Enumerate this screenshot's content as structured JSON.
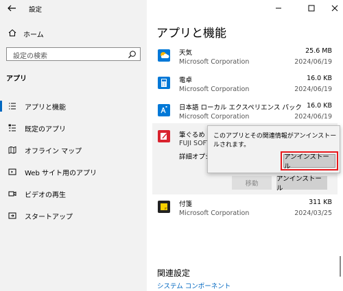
{
  "window": {
    "title": "設定",
    "controls": [
      "minimize",
      "maximize",
      "close"
    ]
  },
  "sidebar": {
    "home_label": "ホーム",
    "search_placeholder": "設定の検索",
    "section_label": "アプリ",
    "items": [
      {
        "label": "アプリと機能",
        "icon": "list-icon",
        "selected": true
      },
      {
        "label": "既定のアプリ",
        "icon": "default-apps-icon",
        "selected": false
      },
      {
        "label": "オフライン マップ",
        "icon": "map-icon",
        "selected": false
      },
      {
        "label": "Web サイト用のアプリ",
        "icon": "web-icon",
        "selected": false
      },
      {
        "label": "ビデオの再生",
        "icon": "video-icon",
        "selected": false
      },
      {
        "label": "スタートアップ",
        "icon": "startup-icon",
        "selected": false
      }
    ]
  },
  "main": {
    "title": "アプリと機能",
    "apps": [
      {
        "name": "天気",
        "publisher": "Microsoft Corporation",
        "size": "25.6 MB",
        "date": "2024/06/19",
        "icon": "weather-icon",
        "color": "#0078d7"
      },
      {
        "name": "電卓",
        "publisher": "Microsoft Corporation",
        "size": "16.0 KB",
        "date": "2024/06/19",
        "icon": "calculator-icon",
        "color": "#0078d7"
      },
      {
        "name": "日本語 ローカル エクスペリエンス パック",
        "publisher": "Microsoft Corporation",
        "size": "16.0 KB",
        "date": "2024/06/19",
        "icon": "language-icon",
        "color": "#0078d7"
      }
    ],
    "expanded_app": {
      "name": "筆ぐるめ 2(",
      "publisher": "FUJI SOFT",
      "advanced_options": "詳細オプシ",
      "icon": "fudegurume-icon",
      "color": "#d9232e",
      "move_label": "移動",
      "uninstall_label": "アンインストール"
    },
    "popup": {
      "message": "このアプリとその関連情報がアンインストールされます。",
      "uninstall_label": "アンインストール"
    },
    "apps_after": [
      {
        "name": "付箋",
        "publisher": "Microsoft Corporation",
        "size": "311 KB",
        "date": "2024/03/25",
        "icon": "sticky-notes-icon",
        "color": "#222222"
      }
    ],
    "related_title": "関連設定",
    "related_link": "システム コンポーネント"
  },
  "colors": {
    "accent": "#0067c0",
    "highlight": "#e8191c"
  }
}
